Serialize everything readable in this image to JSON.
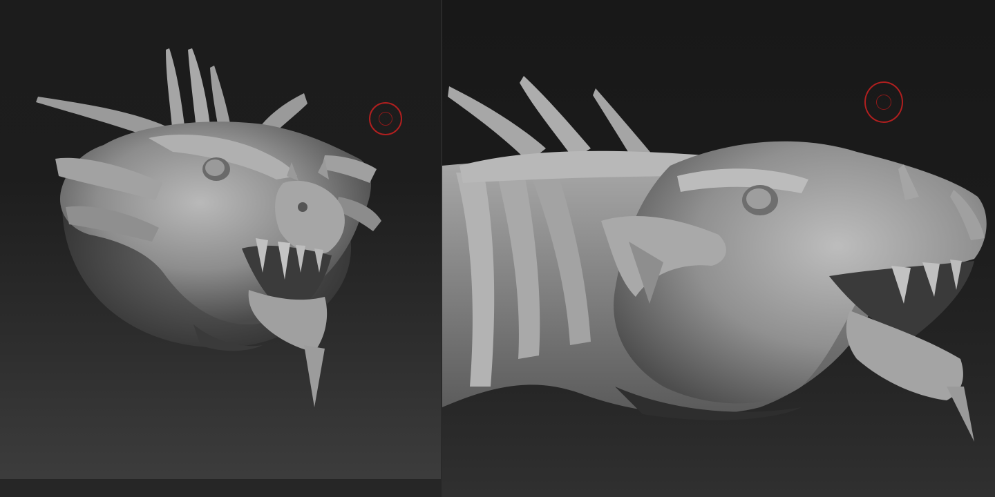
{
  "viewports": [
    {
      "name": "front-three-quarter-view",
      "brush_cursor_color": "#b01f1f",
      "model_color": "#8f8f8f"
    },
    {
      "name": "side-profile-view",
      "brush_cursor_color": "#b01f1f",
      "model_color": "#8f8f8f"
    }
  ],
  "model": {
    "subject": "dragon-head-sculpt",
    "material": "matcap-gray"
  }
}
